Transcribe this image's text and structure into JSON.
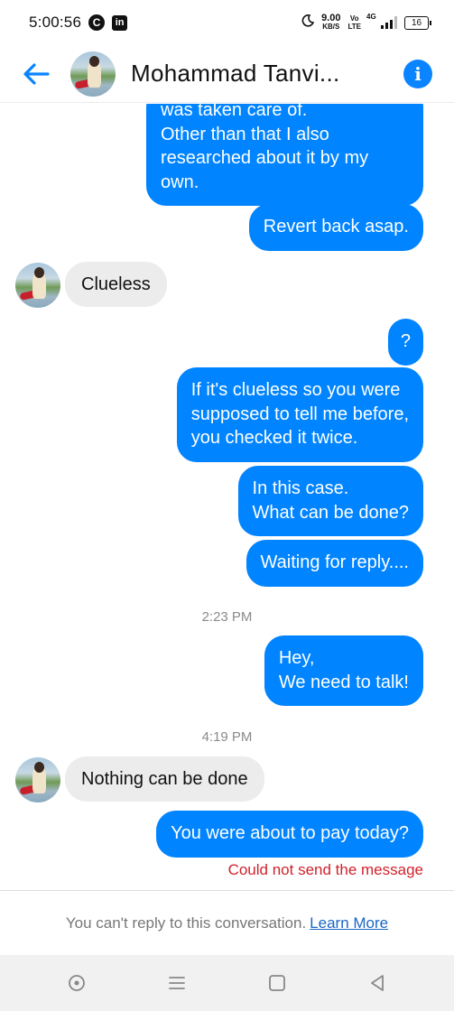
{
  "status_bar": {
    "time": "5:00:56",
    "icons_left": [
      "c-icon",
      "linkedin-icon"
    ],
    "c_glyph": "C",
    "in_glyph": "in",
    "speed_value": "9.00",
    "speed_unit": "KB/S",
    "volte_top": "Vo",
    "volte_bottom": "LTE",
    "network": "4G",
    "battery": "16"
  },
  "header": {
    "title": "Mohammad Tanvi...",
    "info_glyph": "i"
  },
  "colors": {
    "accent": "#0084ff",
    "incoming_bubble": "#ececec",
    "error": "#d0232c",
    "link": "#1a66c4"
  },
  "messages": {
    "m1": "was taken care of.\nOther than that I also\nresearched about it by my\nown.",
    "m2": "Revert back asap.",
    "m3": "Clueless",
    "m4": "?",
    "m5": "If it's clueless so you were\nsupposed to tell me before,\nyou checked it twice.",
    "m6": "In this case.\nWhat can be done?",
    "m7": "Waiting for reply....",
    "t1": "2:23 PM",
    "m8": "Hey,\nWe need to talk!",
    "t2": "4:19 PM",
    "m9": "Nothing can be done",
    "m10": "You were about to pay today?",
    "error": "Could not send the message"
  },
  "footer": {
    "text": "You can't reply to this conversation.",
    "link": "Learn More"
  },
  "nav": {
    "items": [
      "assistant-circle-icon",
      "recents-menu-icon",
      "home-square-icon",
      "back-triangle-icon"
    ]
  }
}
